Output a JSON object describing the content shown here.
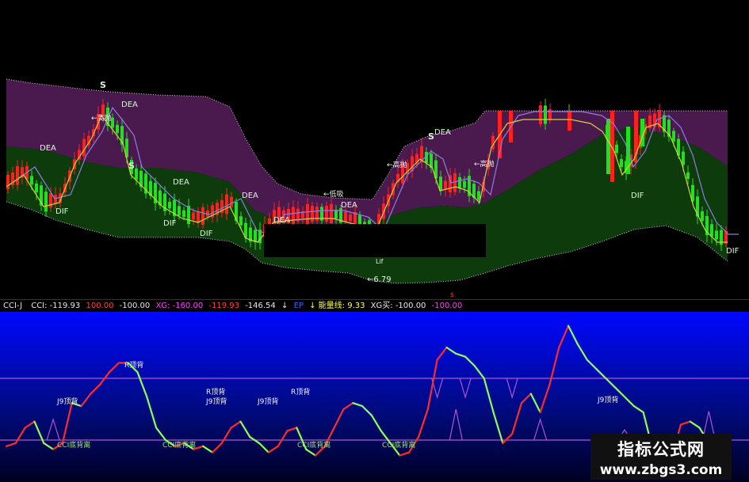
{
  "colors": {
    "up": "#ff2020",
    "down": "#20e020",
    "upper_band": "#4a1a4e",
    "lower_band": "#0e3b0c",
    "band_edge": "#cfcfcf",
    "indicator_bg_top": "#0008ff",
    "indicator_bg_bottom": "#000022",
    "level_line": "#b055d0",
    "osc_up": "#ff2a2a",
    "osc_down": "#8aff5a"
  },
  "top_chart": {
    "ma_labels": [
      "DEA",
      "DIF"
    ],
    "signals": [
      "S",
      "S",
      "S"
    ],
    "markers": [
      "←高抛",
      "←高抛",
      "←高抛",
      "←低吸"
    ],
    "price_note": "←6.79",
    "bottom_marker": "s",
    "label_lif": "Lif"
  },
  "indicator_bar": {
    "name": "CCI-J",
    "items": [
      {
        "text": "CCI: -119.93",
        "color": "#e8e8e8"
      },
      {
        "text": "100.00",
        "color": "#ff4040"
      },
      {
        "text": "-100.00",
        "color": "#e8e8e8"
      },
      {
        "text": "XG: -160.00",
        "color": "#ff40ff"
      },
      {
        "text": "-119.93",
        "color": "#ff4040"
      },
      {
        "text": "-146.54",
        "color": "#e8e8e8"
      },
      {
        "text": "↓",
        "color": "#e8e8e8"
      },
      {
        "text": "EP",
        "color": "#4060ff"
      },
      {
        "text": "↓ 能量线: 9.33",
        "color": "#ffff40"
      },
      {
        "text": "XG买: -100.00",
        "color": "#e8e8e8"
      },
      {
        "text": "-100.00",
        "color": "#ff40ff"
      }
    ]
  },
  "bottom_chart": {
    "labels": [
      "R顶背",
      "J9顶背",
      "R顶背",
      "J9顶背",
      "J9顶背",
      "R顶背",
      "J9顶背",
      "CCI底背离",
      "CCI底背离",
      "CCI底背离",
      "CCI底背离"
    ]
  },
  "chart_data": {
    "type": "line",
    "series": [
      {
        "values": [
          -120,
          -110,
          -60,
          -40,
          -110,
          -130,
          -110,
          20,
          10,
          50,
          80,
          120,
          150,
          150,
          120,
          40,
          -60,
          -100,
          -120,
          -110,
          -130,
          -120,
          -140,
          -110,
          -60,
          -40,
          -90,
          -110,
          -140,
          -120,
          -70,
          -60,
          -130,
          -150,
          -120,
          -60,
          0,
          20,
          10,
          -20,
          -70,
          -110,
          -150,
          -140,
          -90,
          0,
          160,
          200,
          180,
          170,
          140,
          100,
          -10,
          -110,
          -80,
          20,
          50,
          -10,
          80,
          200,
          270,
          210,
          160,
          130,
          100,
          70,
          40,
          10,
          -10,
          -130,
          -180,
          -160,
          -50,
          -40,
          -60,
          -110,
          -140,
          -160
        ]
      }
    ],
    "reference_levels": [
      100,
      -100
    ]
  }
}
